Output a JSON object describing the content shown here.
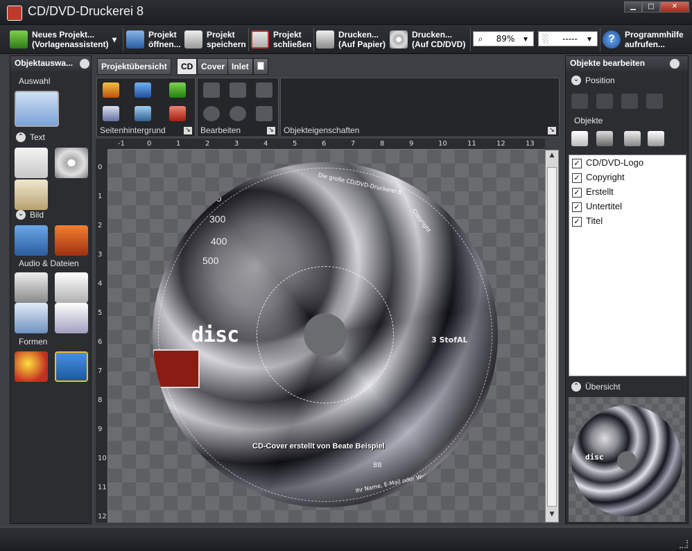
{
  "window": {
    "title": "CD/DVD-Druckerei 8",
    "min_label": "▁",
    "max_label": "□",
    "close_label": "✕"
  },
  "toolbar": {
    "new_project": "Neues Projekt... (Vorlagenassistent)",
    "open_project": "Projekt öffnen...",
    "save_project": "Projekt speichern",
    "close_project": "Projekt schließen",
    "print_paper": "Drucken... (Auf Papier)",
    "print_cd": "Drucken... (Auf CD/DVD)",
    "zoom": "89%",
    "style_combo": "-----",
    "help": "Programmhilfe aufrufen..."
  },
  "left_panel": {
    "title": "Objektauswa...",
    "sections": {
      "selection": "Auswahl",
      "text": "Text",
      "image": "Bild",
      "audio": "Audio & Dateien",
      "shapes": "Formen"
    }
  },
  "tabs": [
    {
      "label": "Projektübersicht"
    },
    {
      "label": "CD"
    },
    {
      "label": "Cover"
    },
    {
      "label": "Inlet"
    }
  ],
  "ribbon": {
    "background": "Seitenhintergrund",
    "edit": "Bearbeiten",
    "properties": "Objekteigenschaften"
  },
  "rulers": {
    "h": [
      "-1",
      "0",
      "1",
      "2",
      "3",
      "4",
      "5",
      "6",
      "7",
      "8",
      "9",
      "10",
      "11",
      "12",
      "13"
    ],
    "v": [
      "0",
      "1",
      "2",
      "3",
      "4",
      "5",
      "6",
      "7",
      "8",
      "9",
      "10",
      "11",
      "12"
    ]
  },
  "cd": {
    "disc_text": "disc",
    "gauge": [
      "00",
      "300",
      "400",
      "500"
    ],
    "caption": "CD-Cover erstellt von Beate Beispiel",
    "rim_text_top": "Die große CD/DVD-Druckerei 8",
    "rim_text_right": "Copyright",
    "rim_text_bottom": "Ihr Name, E-Mail oder Web",
    "label_bg": "3 StofAL",
    "counter": "88"
  },
  "right_panel": {
    "title": "Objekte bearbeiten",
    "position_label": "Position",
    "objects_label": "Objekte",
    "objects": [
      "CD/DVD-Logo",
      "Copyright",
      "Erstellt",
      "Untertitel",
      "Titel"
    ],
    "overview_label": "Übersicht",
    "preview_disc_text": "disc"
  },
  "icons": {
    "check": "✓",
    "chevron_up": "⌃",
    "chevron_down": "⌄",
    "dropdown": "▾",
    "corner": "↘",
    "help": "?"
  },
  "colors": {
    "accent": "#2a6fd0",
    "panel": "#2b2d31",
    "canvas": "#6b6c70"
  }
}
